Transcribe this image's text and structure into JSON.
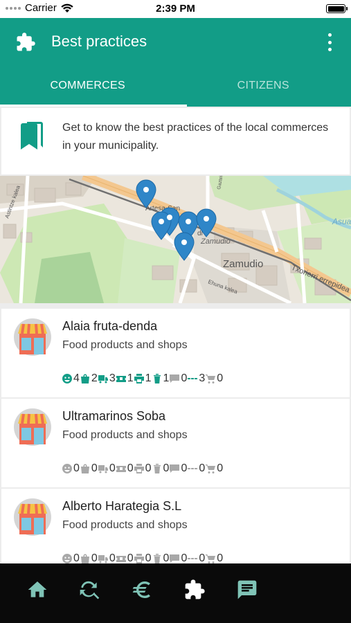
{
  "status_bar": {
    "carrier": "Carrier",
    "time": "2:39 PM"
  },
  "header": {
    "title": "Best practices"
  },
  "tabs": [
    {
      "label": "COMMERCES",
      "active": true
    },
    {
      "label": "CITIZENS",
      "active": false
    }
  ],
  "intro": {
    "text": "Get to know the best practices of the local commerces in your municipality."
  },
  "map": {
    "labels": {
      "town": "Zamudio",
      "town_small": "Zamudio",
      "road": "Txorierri errepidea",
      "street_1": "Artesa-San",
      "street_2": "Astintze kalea",
      "street_3": "Ehuna kalea",
      "area": "Asua",
      "road_b": "Gaztelu",
      "short": "di"
    }
  },
  "commerces": [
    {
      "name": "Alaia fruta-denda",
      "category": "Food products and shops",
      "stats": [
        {
          "icon": "face-icon",
          "value": "4",
          "active": true
        },
        {
          "icon": "bag-icon",
          "value": "2",
          "active": true
        },
        {
          "icon": "truck-icon",
          "value": "3",
          "active": true
        },
        {
          "icon": "ticket-icon",
          "value": "1",
          "active": true
        },
        {
          "icon": "printer-icon",
          "value": "1",
          "active": true
        },
        {
          "icon": "trash-icon",
          "value": "1",
          "active": true
        },
        {
          "icon": "comment-icon",
          "value": "0",
          "active": false
        },
        {
          "icon": "dots-icon",
          "value": "3",
          "active": true
        },
        {
          "icon": "cart-icon",
          "value": "0",
          "active": false
        }
      ]
    },
    {
      "name": "Ultramarinos Soba",
      "category": "Food products and shops",
      "stats": [
        {
          "icon": "face-icon",
          "value": "0",
          "active": false
        },
        {
          "icon": "bag-icon",
          "value": "0",
          "active": false
        },
        {
          "icon": "truck-icon",
          "value": "0",
          "active": false
        },
        {
          "icon": "ticket-icon",
          "value": "0",
          "active": false
        },
        {
          "icon": "printer-icon",
          "value": "0",
          "active": false
        },
        {
          "icon": "trash-icon",
          "value": "0",
          "active": false
        },
        {
          "icon": "comment-icon",
          "value": "0",
          "active": false
        },
        {
          "icon": "dots-icon",
          "value": "0",
          "active": false
        },
        {
          "icon": "cart-icon",
          "value": "0",
          "active": false
        }
      ]
    },
    {
      "name": "Alberto Harategia S.L",
      "category": "Food products and shops",
      "stats": [
        {
          "icon": "face-icon",
          "value": "0",
          "active": false
        },
        {
          "icon": "bag-icon",
          "value": "0",
          "active": false
        },
        {
          "icon": "truck-icon",
          "value": "0",
          "active": false
        },
        {
          "icon": "ticket-icon",
          "value": "0",
          "active": false
        },
        {
          "icon": "printer-icon",
          "value": "0",
          "active": false
        },
        {
          "icon": "trash-icon",
          "value": "0",
          "active": false
        },
        {
          "icon": "comment-icon",
          "value": "0",
          "active": false
        },
        {
          "icon": "dots-icon",
          "value": "0",
          "active": false
        },
        {
          "icon": "cart-icon",
          "value": "0",
          "active": false
        }
      ]
    }
  ],
  "bottom_nav": [
    {
      "icon": "home-icon",
      "active": false
    },
    {
      "icon": "search-refresh-icon",
      "active": false
    },
    {
      "icon": "euro-icon",
      "active": false
    },
    {
      "icon": "puzzle-icon",
      "active": true
    },
    {
      "icon": "chat-icon",
      "active": false
    }
  ],
  "colors": {
    "primary": "#129d87",
    "inactive_icon": "#a8a8a8",
    "nav_inactive": "#7fc3b6",
    "marker": "#2f86c8"
  }
}
